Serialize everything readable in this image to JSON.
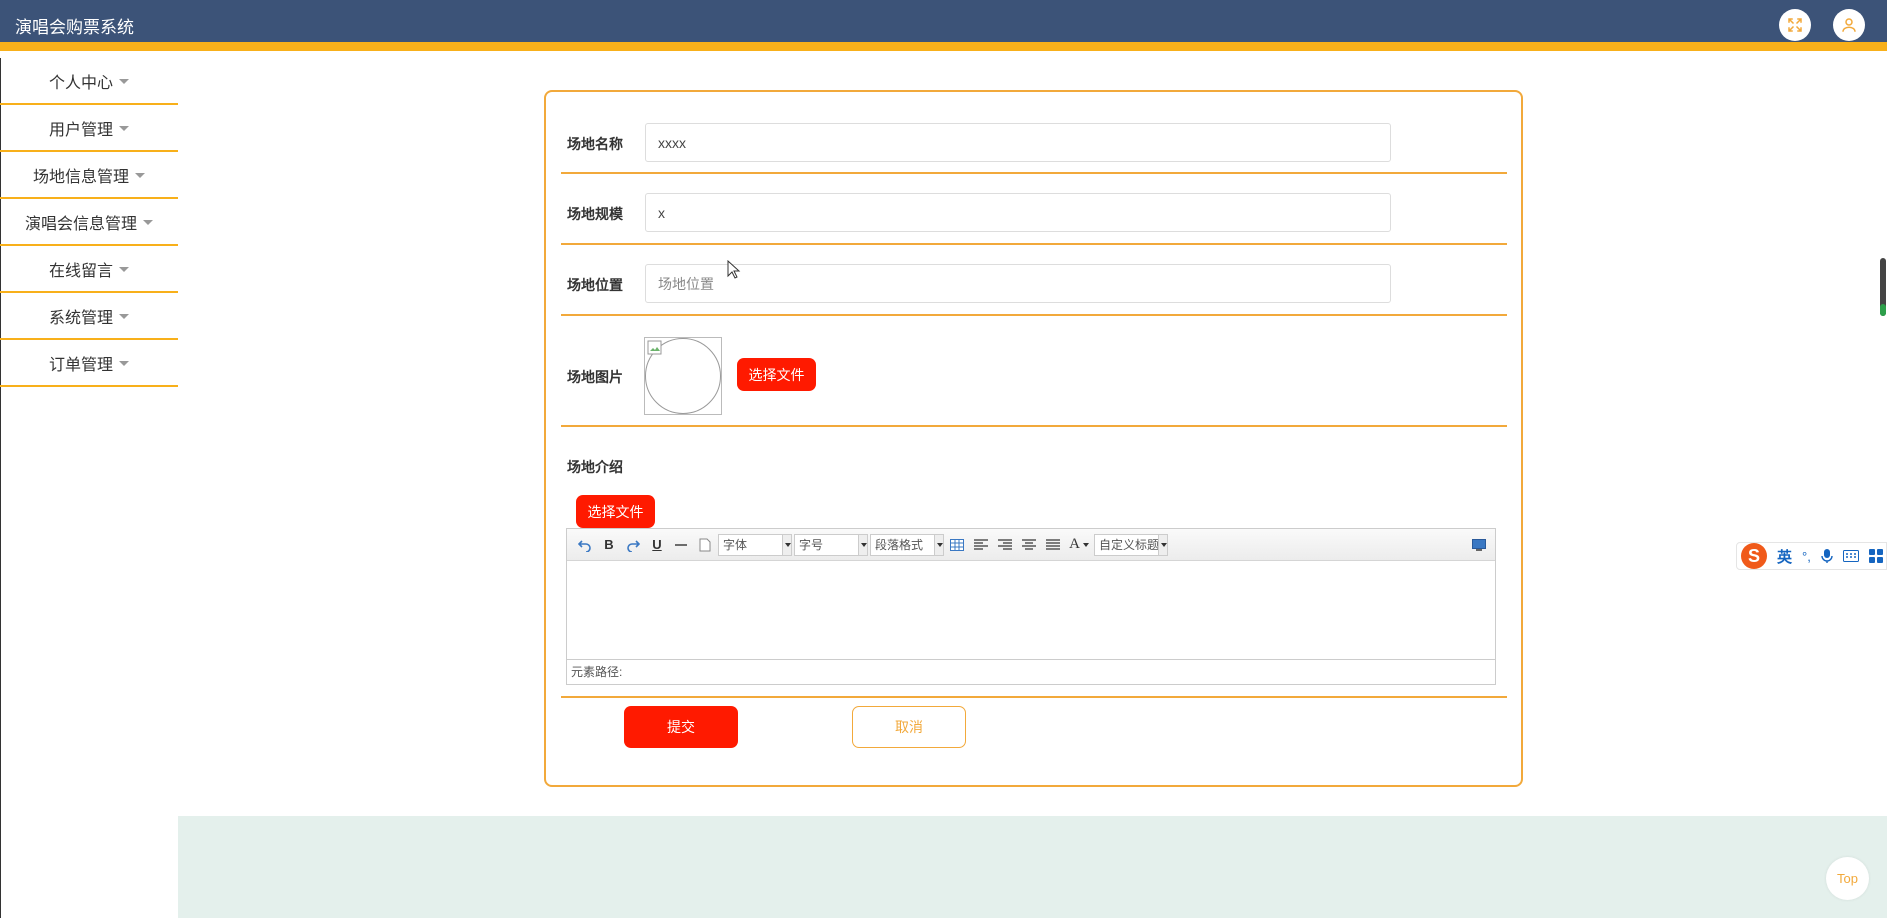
{
  "app": {
    "title": "演唱会购票系统"
  },
  "sidebar": {
    "items": [
      {
        "label": "个人中心"
      },
      {
        "label": "用户管理"
      },
      {
        "label": "场地信息管理"
      },
      {
        "label": "演唱会信息管理"
      },
      {
        "label": "在线留言"
      },
      {
        "label": "系统管理"
      },
      {
        "label": "订单管理"
      }
    ]
  },
  "form": {
    "name": {
      "label": "场地名称",
      "value": "xxxx"
    },
    "scale": {
      "label": "场地规模",
      "value": "x"
    },
    "location": {
      "label": "场地位置",
      "value": "",
      "placeholder": "场地位置"
    },
    "image": {
      "label": "场地图片",
      "choose_label": "选择文件"
    },
    "intro": {
      "label": "场地介绍",
      "choose_label": "选择文件"
    },
    "submit_label": "提交",
    "cancel_label": "取消"
  },
  "editor": {
    "toolbar": {
      "bold": "B",
      "underline": "U",
      "font_family": "字体",
      "font_size": "字号",
      "paragraph": "段落格式",
      "font_color": "A",
      "custom_title": "自定义标题"
    },
    "status_label": "元素路径:"
  },
  "ime": {
    "lang": "英",
    "punct": "°,"
  },
  "top_button": "Top",
  "colors": {
    "header": "#3c5378",
    "accent": "#f8b01a",
    "button_red": "#ff1a00",
    "footer": "#e4f0ec"
  }
}
